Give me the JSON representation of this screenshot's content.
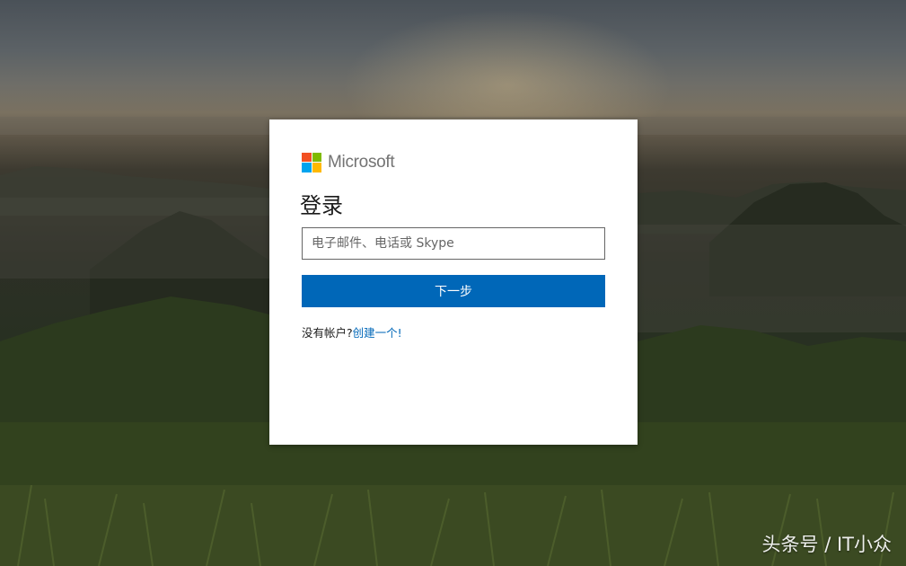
{
  "brand": {
    "name": "Microsoft",
    "logo_colors": [
      "#f25022",
      "#7fba00",
      "#00a4ef",
      "#ffb900"
    ],
    "text_color": "#737373"
  },
  "signin": {
    "title": "登录",
    "email_placeholder": "电子邮件、电话或 Skype",
    "email_value": "",
    "next_label": "下一步",
    "no_account_text": "没有帐户?",
    "create_link": "创建一个!"
  },
  "colors": {
    "primary": "#0067b8",
    "text": "#1b1b1b",
    "border": "#666666"
  },
  "watermark": {
    "text": "头条号 / IT小众"
  }
}
